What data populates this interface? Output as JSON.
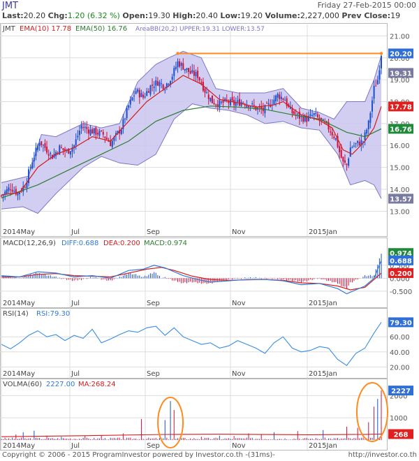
{
  "header": {
    "symbol": "JMT",
    "date": "Friday 27-Feb-2015 00:00",
    "last_label": "Last:",
    "last": "20.20",
    "chg_label": "Chg:",
    "chg": "1.20 (6.32 %)",
    "open_label": "Open:",
    "open": "19.30",
    "high_label": "High:",
    "high": "20.40",
    "low_label": "Low:",
    "low": "19.20",
    "volume_label": "Volume:",
    "volume": "2,227,000",
    "prev_close_label": "Prev Close:",
    "prev_close": "19"
  },
  "colors": {
    "up": "#1a4fd0",
    "down": "#d0103a",
    "ema10": "#d41c1c",
    "ema50": "#2e7d32",
    "band_fill": "#c9c6ee",
    "band_line": "#7b76c8",
    "orange": "#ff8a1e",
    "grid": "#dddddd",
    "badge_blue": "#2f6fd6",
    "badge_red": "#e02020",
    "badge_green": "#1f8a3a",
    "badge_gray": "#7a7aa0"
  },
  "chart_data": [
    {
      "type": "candlestick",
      "legend": {
        "symbol": "JMT",
        "ema10": "EMA(10) 17.78",
        "ema50": "EMA(50) 16.76",
        "bb": "AreaBB(20,2) UPPER:19.31 LOWER:13.57"
      },
      "x_labels": [
        "2014May",
        "Jul",
        "Sep",
        "Nov",
        "2015Jan"
      ],
      "y_ticks": [
        "21.00",
        "20.00",
        "19.00",
        "18.00",
        "17.00",
        "16.00",
        "15.00",
        "14.00",
        "13.00"
      ],
      "ylim": [
        12.5,
        21.3
      ],
      "price_path": [
        [
          0,
          13.7
        ],
        [
          5,
          14.1
        ],
        [
          9,
          13.8
        ],
        [
          13,
          14.2
        ],
        [
          17,
          15.3
        ],
        [
          21,
          16.2
        ],
        [
          25,
          15.8
        ],
        [
          28,
          15.5
        ],
        [
          32,
          15.9
        ],
        [
          36,
          15.7
        ],
        [
          40,
          16.0
        ],
        [
          44,
          16.9
        ],
        [
          48,
          16.7
        ],
        [
          52,
          16.6
        ],
        [
          56,
          16.5
        ],
        [
          60,
          16.1
        ],
        [
          62,
          16.3
        ],
        [
          66,
          16.8
        ],
        [
          70,
          17.8
        ],
        [
          74,
          18.5
        ],
        [
          78,
          18.2
        ],
        [
          82,
          18.7
        ],
        [
          86,
          18.9
        ],
        [
          90,
          18.7
        ],
        [
          94,
          19.2
        ],
        [
          97,
          19.8
        ],
        [
          100,
          19.6
        ],
        [
          104,
          19.3
        ],
        [
          108,
          19.2
        ],
        [
          112,
          18.5
        ],
        [
          116,
          18.0
        ],
        [
          120,
          17.9
        ],
        [
          124,
          18.0
        ],
        [
          128,
          17.9
        ],
        [
          132,
          18.0
        ],
        [
          136,
          17.9
        ],
        [
          140,
          17.7
        ],
        [
          144,
          17.6
        ],
        [
          148,
          17.9
        ],
        [
          152,
          18.3
        ],
        [
          156,
          18.1
        ],
        [
          158,
          17.7
        ],
        [
          160,
          17.5
        ],
        [
          164,
          17.3
        ],
        [
          168,
          17.2
        ],
        [
          172,
          17.4
        ],
        [
          176,
          17.1
        ],
        [
          180,
          16.8
        ],
        [
          184,
          16.3
        ],
        [
          186,
          15.7
        ],
        [
          188,
          15.2
        ],
        [
          190,
          15.1
        ],
        [
          192,
          15.9
        ],
        [
          196,
          16.1
        ],
        [
          199,
          16.2
        ],
        [
          202,
          17.0
        ],
        [
          205,
          18.6
        ],
        [
          207,
          19.0
        ],
        [
          209,
          20.2
        ]
      ],
      "ema10_path": [
        [
          0,
          13.75
        ],
        [
          10,
          13.85
        ],
        [
          20,
          15.0
        ],
        [
          30,
          15.6
        ],
        [
          40,
          15.9
        ],
        [
          50,
          16.4
        ],
        [
          60,
          16.2
        ],
        [
          70,
          17.1
        ],
        [
          80,
          18.0
        ],
        [
          90,
          18.6
        ],
        [
          100,
          19.2
        ],
        [
          110,
          18.8
        ],
        [
          120,
          18.1
        ],
        [
          130,
          17.95
        ],
        [
          140,
          17.75
        ],
        [
          150,
          17.85
        ],
        [
          155,
          18.0
        ],
        [
          165,
          17.4
        ],
        [
          175,
          17.15
        ],
        [
          182,
          16.8
        ],
        [
          188,
          15.8
        ],
        [
          193,
          15.6
        ],
        [
          200,
          16.2
        ],
        [
          205,
          16.8
        ],
        [
          209,
          17.78
        ]
      ],
      "ema50_path": [
        [
          0,
          13.6
        ],
        [
          20,
          14.2
        ],
        [
          40,
          15.0
        ],
        [
          55,
          15.6
        ],
        [
          70,
          16.2
        ],
        [
          85,
          17.1
        ],
        [
          100,
          17.6
        ],
        [
          115,
          17.8
        ],
        [
          130,
          17.75
        ],
        [
          145,
          17.65
        ],
        [
          160,
          17.4
        ],
        [
          175,
          17.2
        ],
        [
          190,
          16.6
        ],
        [
          200,
          16.4
        ],
        [
          209,
          16.76
        ]
      ],
      "bb_upper": [
        [
          0,
          14.3
        ],
        [
          15,
          14.6
        ],
        [
          22,
          16.5
        ],
        [
          30,
          16.4
        ],
        [
          45,
          17.0
        ],
        [
          55,
          16.8
        ],
        [
          65,
          17.0
        ],
        [
          75,
          18.9
        ],
        [
          85,
          19.7
        ],
        [
          92,
          20.0
        ],
        [
          100,
          20.3
        ],
        [
          110,
          20.0
        ],
        [
          118,
          18.6
        ],
        [
          130,
          18.4
        ],
        [
          145,
          18.4
        ],
        [
          155,
          18.6
        ],
        [
          165,
          17.7
        ],
        [
          175,
          17.5
        ],
        [
          183,
          17.2
        ],
        [
          190,
          18.0
        ],
        [
          200,
          18.0
        ],
        [
          205,
          19.0
        ],
        [
          209,
          20.1
        ]
      ],
      "bb_lower": [
        [
          0,
          13.1
        ],
        [
          12,
          13.2
        ],
        [
          20,
          12.9
        ],
        [
          30,
          13.8
        ],
        [
          45,
          15.0
        ],
        [
          55,
          15.5
        ],
        [
          65,
          15.2
        ],
        [
          75,
          15.1
        ],
        [
          85,
          15.6
        ],
        [
          95,
          17.2
        ],
        [
          105,
          17.9
        ],
        [
          115,
          17.7
        ],
        [
          125,
          17.6
        ],
        [
          135,
          17.4
        ],
        [
          145,
          17.0
        ],
        [
          155,
          17.1
        ],
        [
          165,
          16.8
        ],
        [
          175,
          16.7
        ],
        [
          185,
          15.6
        ],
        [
          192,
          14.2
        ],
        [
          200,
          14.4
        ],
        [
          205,
          14.2
        ],
        [
          209,
          13.57
        ]
      ],
      "resistance": {
        "from_x": 97,
        "to_x": 209,
        "value": 20.2
      },
      "badges": [
        {
          "label": "20.20",
          "value": 20.2,
          "color_key": "badge_blue"
        },
        {
          "label": "19.31",
          "value": 19.31,
          "color_key": "badge_gray"
        },
        {
          "label": "17.78",
          "value": 17.78,
          "color_key": "badge_red"
        },
        {
          "label": "16.76",
          "value": 16.76,
          "color_key": "badge_green"
        },
        {
          "label": "13.57",
          "value": 13.57,
          "color_key": "badge_gray"
        }
      ]
    },
    {
      "type": "line",
      "legend": {
        "name": "MACD(12,26,9)",
        "diff": "DIFF:0.688",
        "dea": "DEA:0.200",
        "macd": "MACD:0.974"
      },
      "x_labels": [
        "2014May",
        "Jul",
        "Sep",
        "Nov",
        "2015Jan"
      ],
      "y_ticks": [
        "0.500",
        "0.000",
        "-0.500"
      ],
      "ylim": [
        -0.8,
        1.25
      ],
      "diff_path": [
        [
          0,
          0.1
        ],
        [
          10,
          0.05
        ],
        [
          20,
          0.25
        ],
        [
          30,
          0.2
        ],
        [
          40,
          0.05
        ],
        [
          50,
          0.1
        ],
        [
          60,
          0.0
        ],
        [
          70,
          0.3
        ],
        [
          78,
          0.35
        ],
        [
          84,
          0.5
        ],
        [
          90,
          0.4
        ],
        [
          100,
          0.1
        ],
        [
          108,
          -0.05
        ],
        [
          115,
          -0.15
        ],
        [
          125,
          -0.1
        ],
        [
          135,
          -0.05
        ],
        [
          145,
          -0.05
        ],
        [
          155,
          -0.1
        ],
        [
          165,
          -0.25
        ],
        [
          175,
          -0.2
        ],
        [
          185,
          -0.4
        ],
        [
          190,
          -0.6
        ],
        [
          195,
          -0.45
        ],
        [
          200,
          -0.3
        ],
        [
          205,
          0.0
        ],
        [
          209,
          0.688
        ]
      ],
      "dea_path": [
        [
          0,
          0.05
        ],
        [
          10,
          0.05
        ],
        [
          20,
          0.15
        ],
        [
          30,
          0.18
        ],
        [
          40,
          0.1
        ],
        [
          50,
          0.08
        ],
        [
          60,
          0.05
        ],
        [
          70,
          0.2
        ],
        [
          80,
          0.35
        ],
        [
          88,
          0.42
        ],
        [
          95,
          0.3
        ],
        [
          105,
          0.08
        ],
        [
          115,
          -0.05
        ],
        [
          125,
          -0.08
        ],
        [
          135,
          -0.06
        ],
        [
          145,
          -0.05
        ],
        [
          155,
          -0.08
        ],
        [
          165,
          -0.18
        ],
        [
          175,
          -0.2
        ],
        [
          185,
          -0.3
        ],
        [
          192,
          -0.45
        ],
        [
          200,
          -0.35
        ],
        [
          205,
          -0.05
        ],
        [
          209,
          0.2
        ]
      ],
      "badges": [
        {
          "label": "0.974",
          "value": 0.974,
          "color_key": "badge_green"
        },
        {
          "label": "0.688",
          "value": 0.688,
          "color_key": "badge_blue"
        },
        {
          "label": "0.200",
          "value": 0.2,
          "color_key": "badge_red"
        }
      ]
    },
    {
      "type": "line",
      "legend": {
        "name": "RSI(14)",
        "value": "RSI:79.30"
      },
      "x_labels": [
        "2014May",
        "Jul",
        "Sep",
        "Nov",
        "2015Jan"
      ],
      "y_ticks": [
        "60.00",
        "40.00",
        "20.00"
      ],
      "ylim": [
        12,
        88
      ],
      "rsi_path": [
        [
          0,
          50
        ],
        [
          5,
          44
        ],
        [
          10,
          52
        ],
        [
          15,
          62
        ],
        [
          20,
          68
        ],
        [
          25,
          60
        ],
        [
          30,
          63
        ],
        [
          35,
          55
        ],
        [
          40,
          62
        ],
        [
          45,
          58
        ],
        [
          50,
          70
        ],
        [
          55,
          52
        ],
        [
          60,
          57
        ],
        [
          65,
          63
        ],
        [
          70,
          68
        ],
        [
          75,
          66
        ],
        [
          80,
          72
        ],
        [
          85,
          74
        ],
        [
          90,
          62
        ],
        [
          95,
          72
        ],
        [
          100,
          60
        ],
        [
          105,
          55
        ],
        [
          110,
          50
        ],
        [
          115,
          52
        ],
        [
          120,
          45
        ],
        [
          125,
          48
        ],
        [
          130,
          55
        ],
        [
          135,
          50
        ],
        [
          140,
          45
        ],
        [
          145,
          38
        ],
        [
          150,
          52
        ],
        [
          155,
          60
        ],
        [
          160,
          45
        ],
        [
          165,
          40
        ],
        [
          170,
          42
        ],
        [
          175,
          47
        ],
        [
          180,
          45
        ],
        [
          185,
          30
        ],
        [
          190,
          22
        ],
        [
          195,
          38
        ],
        [
          200,
          45
        ],
        [
          205,
          65
        ],
        [
          209,
          79.3
        ]
      ],
      "badges": [
        {
          "label": "79.30",
          "value": 79.3,
          "color_key": "badge_blue"
        }
      ]
    },
    {
      "type": "bar",
      "legend": {
        "name": "VOLMA(60)",
        "value": "2227.00",
        "ma": "MA:268.24"
      },
      "x_labels": [
        "2014May",
        "Jul",
        "Sep",
        "Nov",
        "2015Jan"
      ],
      "y_ticks": [
        "2000",
        "1000"
      ],
      "ylim": [
        0,
        2450
      ],
      "volume_spikes": [
        [
          8,
          250
        ],
        [
          12,
          350
        ],
        [
          18,
          420
        ],
        [
          25,
          200
        ],
        [
          33,
          150
        ],
        [
          46,
          180
        ],
        [
          55,
          210
        ],
        [
          67,
          300
        ],
        [
          77,
          950
        ],
        [
          90,
          900
        ],
        [
          93,
          1750
        ],
        [
          95,
          1350
        ],
        [
          110,
          150
        ],
        [
          120,
          200
        ],
        [
          128,
          180
        ],
        [
          136,
          300
        ],
        [
          143,
          250
        ],
        [
          150,
          350
        ],
        [
          163,
          400
        ],
        [
          177,
          450
        ],
        [
          190,
          600
        ],
        [
          196,
          550
        ],
        [
          202,
          800
        ],
        [
          205,
          1500
        ],
        [
          207,
          1850
        ],
        [
          209,
          2227
        ]
      ],
      "ma_path": [
        [
          0,
          150
        ],
        [
          50,
          200
        ],
        [
          90,
          250
        ],
        [
          120,
          260
        ],
        [
          170,
          240
        ],
        [
          200,
          255
        ],
        [
          209,
          268.24
        ]
      ],
      "badges": [
        {
          "label": "2227",
          "value": 2227,
          "color_key": "badge_blue"
        },
        {
          "label": "268",
          "value": 268.24,
          "color_key": "badge_red"
        }
      ]
    }
  ],
  "footer": {
    "left": "Copyright © 2006 - 2015 ProgramInvestor powered by Investor.co.th -(31ms)-",
    "right": "http://investor.co.th"
  }
}
